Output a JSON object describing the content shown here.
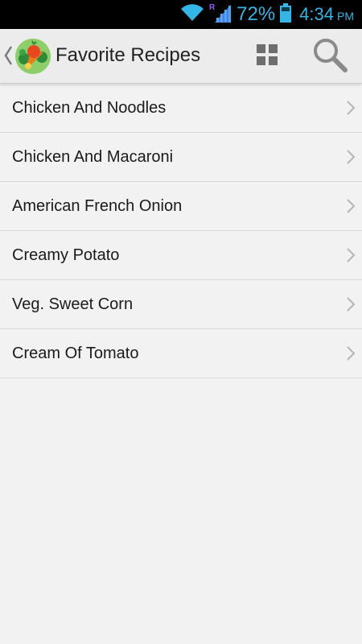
{
  "status_bar": {
    "wifi_icon": "wifi-icon",
    "signal_icon": "signal-roaming-icon",
    "roaming_indicator": "R",
    "battery_percent": "72%",
    "battery_icon": "battery-icon",
    "time": "4:34",
    "ampm": "PM",
    "accent_color": "#33b5e5"
  },
  "action_bar": {
    "up_icon": "chevron-left-icon",
    "logo_icon": "vegetables-logo-icon",
    "title": "Favorite Recipes",
    "grid_icon": "grid-view-icon",
    "search_icon": "search-icon"
  },
  "recipes": [
    {
      "label": "Chicken And Noodles"
    },
    {
      "label": "Chicken And Macaroni"
    },
    {
      "label": "American French Onion"
    },
    {
      "label": "Creamy Potato"
    },
    {
      "label": "Veg. Sweet Corn"
    },
    {
      "label": "Cream Of Tomato"
    }
  ],
  "list_item_icon": "chevron-right-icon"
}
